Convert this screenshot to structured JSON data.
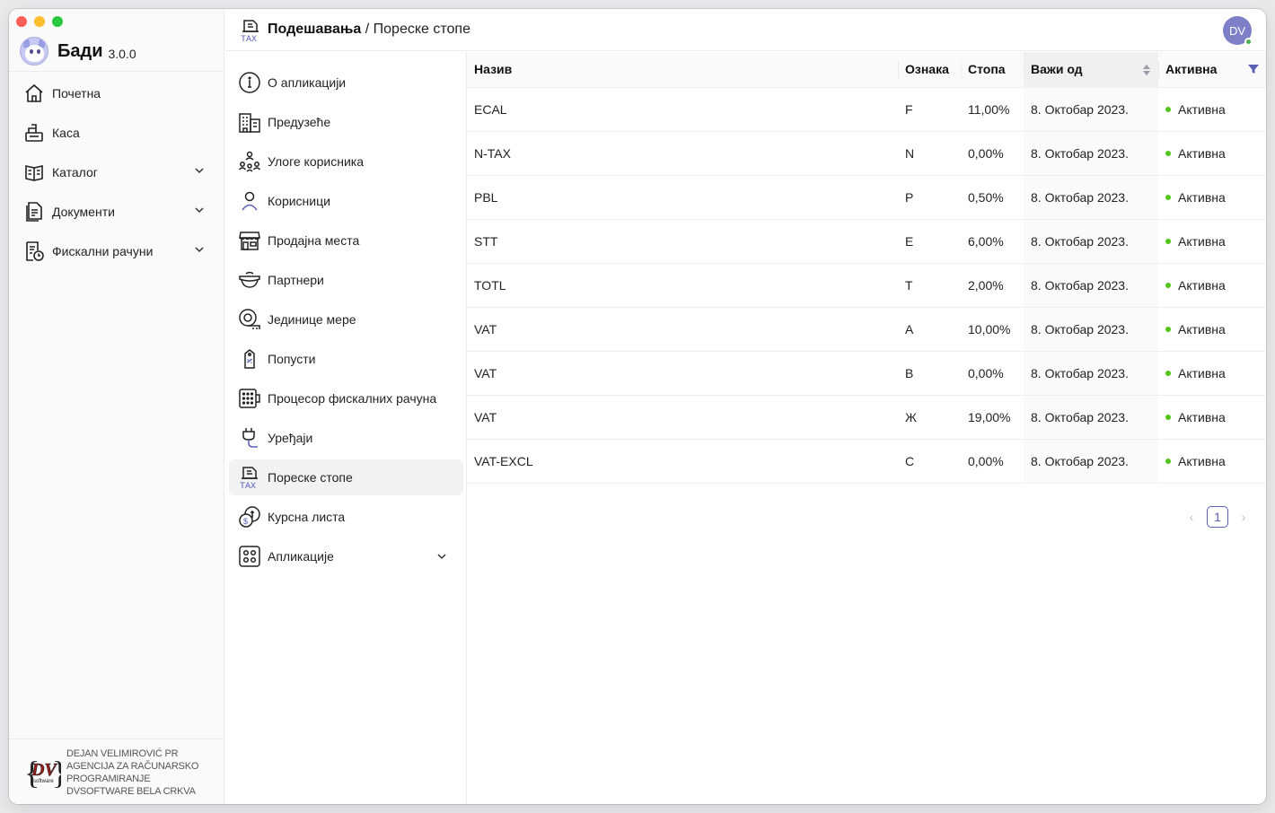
{
  "app": {
    "name": "Бади",
    "version": "3.0.0"
  },
  "colors": {
    "accent": "#5a5fb5",
    "active_dot": "#52c41a",
    "traffic_red": "#ff5f57",
    "traffic_yellow": "#febc2e",
    "traffic_green": "#28c840"
  },
  "sidebar": {
    "items": [
      {
        "label": "Почетна",
        "icon": "home-icon"
      },
      {
        "label": "Каса",
        "icon": "cash-register-icon"
      },
      {
        "label": "Каталог",
        "icon": "catalog-icon"
      },
      {
        "label": "Документи",
        "icon": "documents-icon"
      },
      {
        "label": "Фискални рачуни",
        "icon": "fiscal-receipts-icon"
      }
    ],
    "footer": {
      "line1": "DEJAN VELIMIROVIĆ PR",
      "line2": "AGENCIJA ZA RAČUNARSKO",
      "line3": "PROGRAMIRANJE",
      "line4": "DVSOFTWARE BELA CRKVA",
      "logo_text": "DV",
      "logo_sub": "software"
    }
  },
  "header": {
    "breadcrumb_parent": "Подешавања",
    "breadcrumb_sep": "/",
    "breadcrumb_current": "Пореске стопе",
    "avatar_initials": "DV"
  },
  "settings_menu": {
    "items": [
      {
        "label": "О апликацији",
        "icon": "info-icon"
      },
      {
        "label": "Предузеће",
        "icon": "company-building-icon"
      },
      {
        "label": "Улоге корисника",
        "icon": "user-roles-icon"
      },
      {
        "label": "Корисници",
        "icon": "user-icon"
      },
      {
        "label": "Продајна места",
        "icon": "store-icon"
      },
      {
        "label": "Партнери",
        "icon": "partners-icon"
      },
      {
        "label": "Јединице мере",
        "icon": "measure-units-icon"
      },
      {
        "label": "Попусти",
        "icon": "discount-tag-icon"
      },
      {
        "label": "Процесор фискалних рачуна",
        "icon": "fiscal-processor-icon"
      },
      {
        "label": "Уређаји",
        "icon": "device-plug-icon"
      },
      {
        "label": "Пореске стопе",
        "icon": "tax-icon"
      },
      {
        "label": "Курсна листа",
        "icon": "exchange-rate-icon"
      },
      {
        "label": "Апликације",
        "icon": "apps-icon"
      }
    ]
  },
  "table": {
    "columns": [
      "Назив",
      "Ознака",
      "Стопа",
      "Важи од",
      "Активна"
    ],
    "rows": [
      {
        "name": "ECAL",
        "code": "F",
        "rate": "11,00%",
        "valid_from": "8. Октобар 2023.",
        "status": "Активна"
      },
      {
        "name": "N-TAX",
        "code": "N",
        "rate": "0,00%",
        "valid_from": "8. Октобар 2023.",
        "status": "Активна"
      },
      {
        "name": "PBL",
        "code": "P",
        "rate": "0,50%",
        "valid_from": "8. Октобар 2023.",
        "status": "Активна"
      },
      {
        "name": "STT",
        "code": "E",
        "rate": "6,00%",
        "valid_from": "8. Октобар 2023.",
        "status": "Активна"
      },
      {
        "name": "TOTL",
        "code": "T",
        "rate": "2,00%",
        "valid_from": "8. Октобар 2023.",
        "status": "Активна"
      },
      {
        "name": "VAT",
        "code": "A",
        "rate": "10,00%",
        "valid_from": "8. Октобар 2023.",
        "status": "Активна"
      },
      {
        "name": "VAT",
        "code": "B",
        "rate": "0,00%",
        "valid_from": "8. Октобар 2023.",
        "status": "Активна"
      },
      {
        "name": "VAT",
        "code": "Ж",
        "rate": "19,00%",
        "valid_from": "8. Октобар 2023.",
        "status": "Активна"
      },
      {
        "name": "VAT-EXCL",
        "code": "C",
        "rate": "0,00%",
        "valid_from": "8. Октобар 2023.",
        "status": "Активна"
      }
    ]
  },
  "pagination": {
    "current_page": "1",
    "prev": "‹",
    "next": "›"
  }
}
